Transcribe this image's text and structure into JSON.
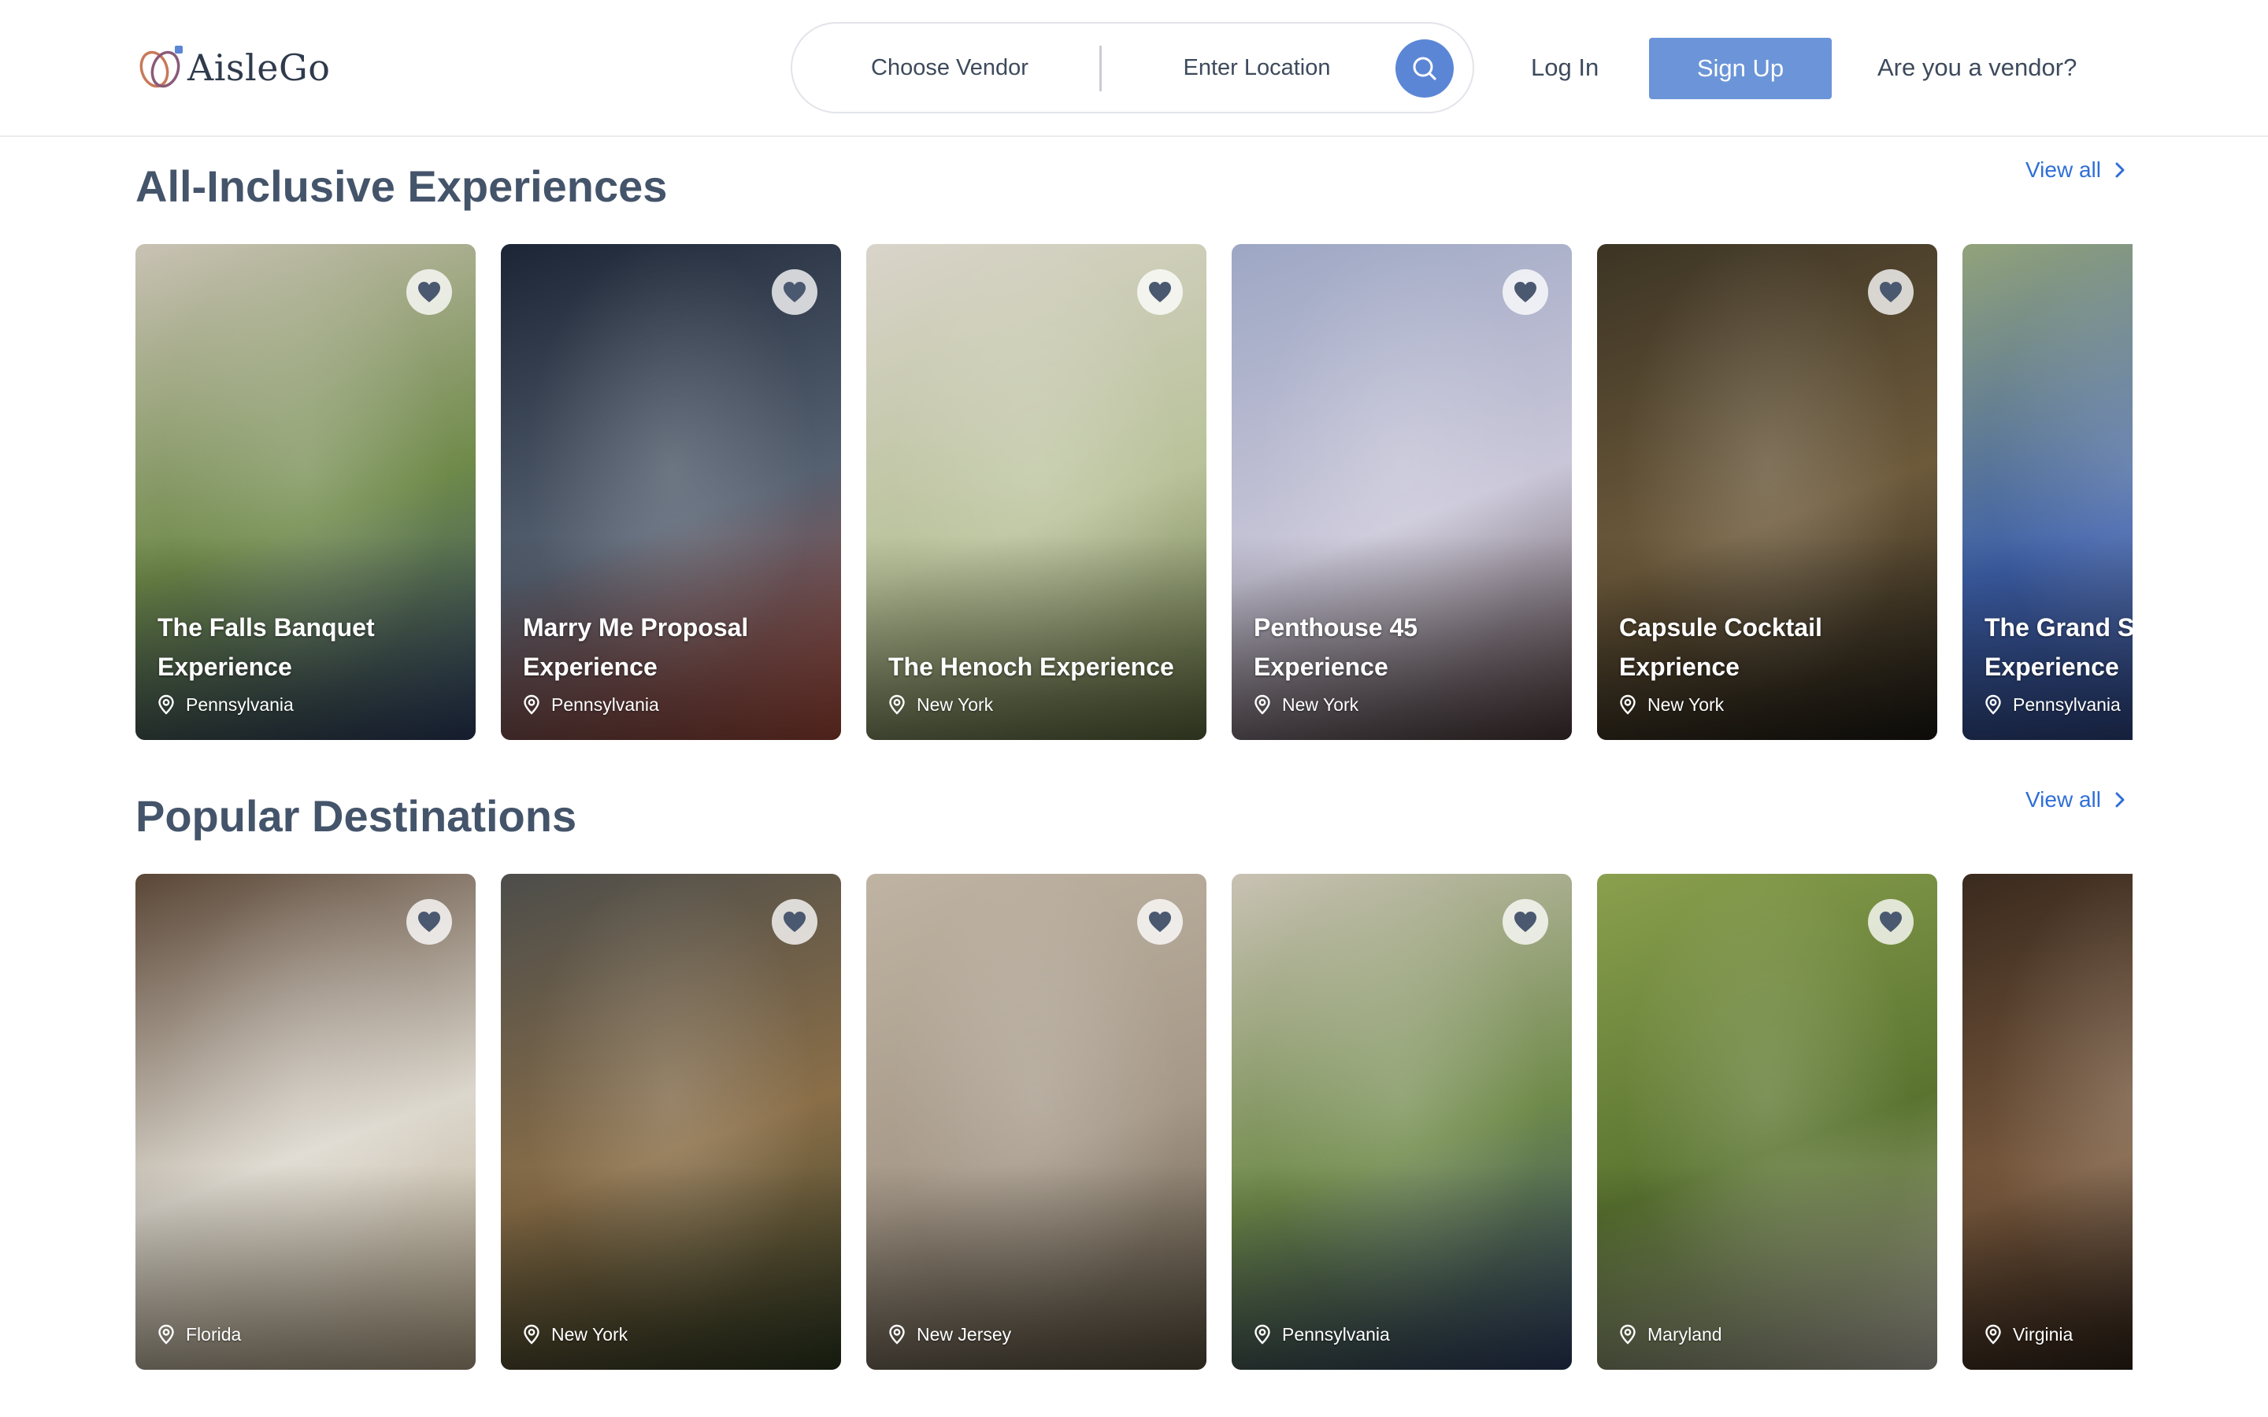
{
  "header": {
    "logo_text": "AisleGo",
    "search": {
      "vendor_label": "Choose Vendor",
      "location_label": "Enter Location"
    },
    "login_label": "Log In",
    "signup_label": "Sign Up",
    "vendor_link": "Are you a vendor?"
  },
  "experiences": {
    "title": "All-Inclusive Experiences",
    "view_all": "View all",
    "cards": [
      {
        "title": "The Falls Banquet Experience",
        "location": "Pennsylvania",
        "colors": [
          "#c9c2b4",
          "#6f8a4a",
          "#2e3f66"
        ]
      },
      {
        "title": "Marry Me Proposal Experience",
        "location": "Pennsylvania",
        "colors": [
          "#1b2535",
          "#556070",
          "#a84a3a"
        ]
      },
      {
        "title": "The Henoch Experience",
        "location": "New York",
        "colors": [
          "#d9d4ca",
          "#b9c29a",
          "#5e6a3d"
        ]
      },
      {
        "title": "Penthouse 45 Experience",
        "location": "New York",
        "colors": [
          "#9da7c4",
          "#c9c6d8",
          "#4c3a3a"
        ]
      },
      {
        "title": "Capsule Cocktail Exprience",
        "location": "New York",
        "colors": [
          "#3c3424",
          "#6d5a3b",
          "#1d1a14"
        ]
      },
      {
        "title": "The Grand Sheraton Experience",
        "location": "Pennsylvania",
        "colors": [
          "#92a37a",
          "#3d5fa8",
          "#2b3f78"
        ]
      }
    ]
  },
  "destinations": {
    "title": "Popular Destinations",
    "view_all": "View all",
    "cards": [
      {
        "location": "Florida",
        "colors": [
          "#5a4636",
          "#dcd7cd",
          "#b9a98c"
        ]
      },
      {
        "location": "New York",
        "colors": [
          "#4d4d4a",
          "#8a6e48",
          "#2f3a22"
        ]
      },
      {
        "location": "New Jersey",
        "colors": [
          "#bfb4a3",
          "#a59888",
          "#5b5140"
        ]
      },
      {
        "location": "Pennsylvania",
        "colors": [
          "#c9c2b4",
          "#6f8a4a",
          "#2e3f66"
        ]
      },
      {
        "location": "Maryland",
        "colors": [
          "#8aa04e",
          "#5a7430",
          "#b7b2a6"
        ]
      },
      {
        "location": "Virginia",
        "colors": [
          "#3a2a1e",
          "#7a5a3e",
          "#1e1510"
        ]
      }
    ]
  },
  "accent_color": "#6b95d8"
}
